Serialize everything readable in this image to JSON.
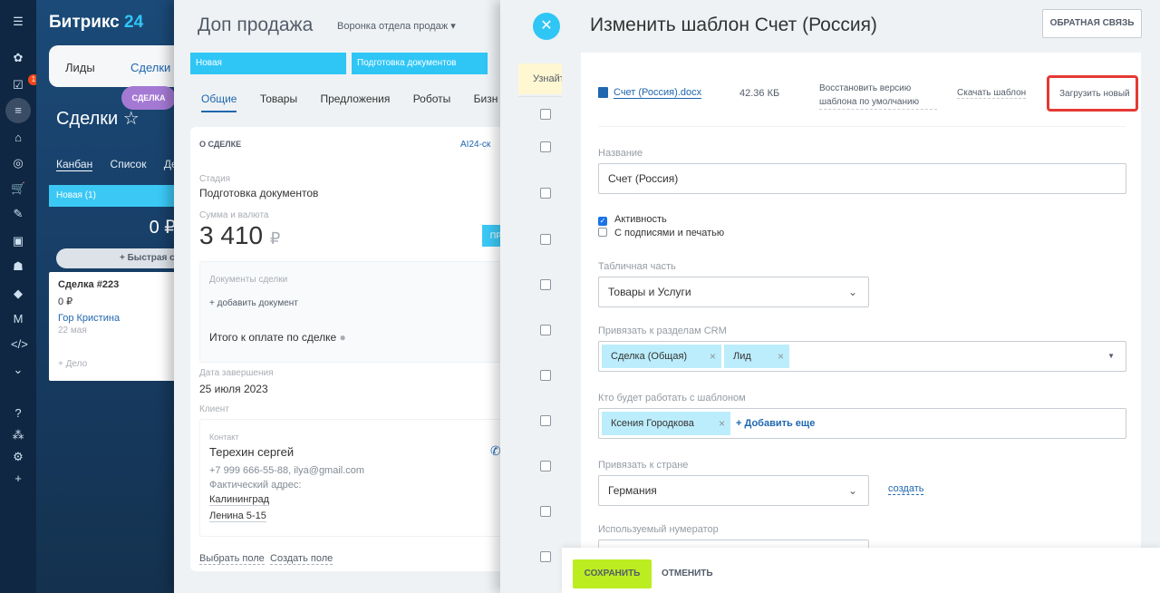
{
  "app": {
    "logo_main": "Битрикс",
    "logo_num": "24",
    "notification_count": "1",
    "menu": [
      "Лиды",
      "Сделки"
    ],
    "deal_chip": "СДЕЛКА",
    "section_title": "Сделки",
    "view_tabs": [
      "Канбан",
      "Список",
      "Де"
    ],
    "column_new": "Новая",
    "column_new_count": "(1)",
    "column_sum": "0 ₽",
    "quick_add": "+ Быстрая с",
    "card": {
      "title": "Сделка #223",
      "sum": "0 ₽",
      "contact": "Гор Кристина",
      "date": "22 мая",
      "task": "+ Дело"
    }
  },
  "deal": {
    "title": "Доп продажа",
    "funnel": "Воронка отдела продаж",
    "stages": [
      "Новая",
      "Подготовка документов"
    ],
    "tabs": [
      "Общие",
      "Товары",
      "Предложения",
      "Роботы",
      "Бизн"
    ],
    "section": "О СДЕЛКЕ",
    "ai_label": "AI24-ск",
    "stage_label": "Стадия",
    "stage_value": "Подготовка документов",
    "sum_label": "Сумма и валюта",
    "sum_value": "3 410",
    "currency": "₽",
    "pay_btn": "ПР",
    "docs_label": "Документы сделки",
    "add_doc": "+ добавить документ",
    "total_label": "Итого к оплате по сделке",
    "end_label": "Дата завершения",
    "end_value": "25 июля 2023",
    "client_label": "Клиент",
    "contact_label": "Контакт",
    "contact_name": "Терехин сергей",
    "contact_info": "+7 999 666-55-88, ilya@gmail.com",
    "address_label": "Фактический адрес:",
    "address_city": "Калининград",
    "address_street": "Ленина 5-15",
    "choose_field": "Выбрать поле",
    "create_field": "Создать поле"
  },
  "list": {
    "banner": "Узнайт"
  },
  "editor": {
    "title": "Изменить шаблон Счет (Россия)",
    "feedback": "ОБРАТНАЯ СВЯЗЬ",
    "file_name": "Счет (Россия).docx",
    "file_size": "42.36 КБ",
    "restore_line1": "Восстановить версию",
    "restore_line2": "шаблона по умолчанию",
    "download": "Скачать шаблон",
    "upload_new": "Загрузить новый",
    "name_label": "Название",
    "name_value": "Счет (Россия)",
    "active_label": "Активность",
    "active_checked": true,
    "stamps_label": "С подписями и печатью",
    "stamps_checked": false,
    "table_label": "Табличная часть",
    "table_value": "Товары и Услуги",
    "crm_label": "Привязать к разделам CRM",
    "crm_tags": [
      "Сделка (Общая)",
      "Лид"
    ],
    "users_label": "Кто будет работать с шаблоном",
    "users_tags": [
      "Ксения Городкова"
    ],
    "add_more": "+ Добавить еще",
    "country_label": "Привязать к стране",
    "country_value": "Германия",
    "create": "создать",
    "numerator_label": "Используемый нумератор",
    "save": "СОХРАНИТЬ",
    "cancel": "ОТМЕНИТЬ",
    "highlight_color": "#e53935",
    "save_color": "#bbed21"
  }
}
